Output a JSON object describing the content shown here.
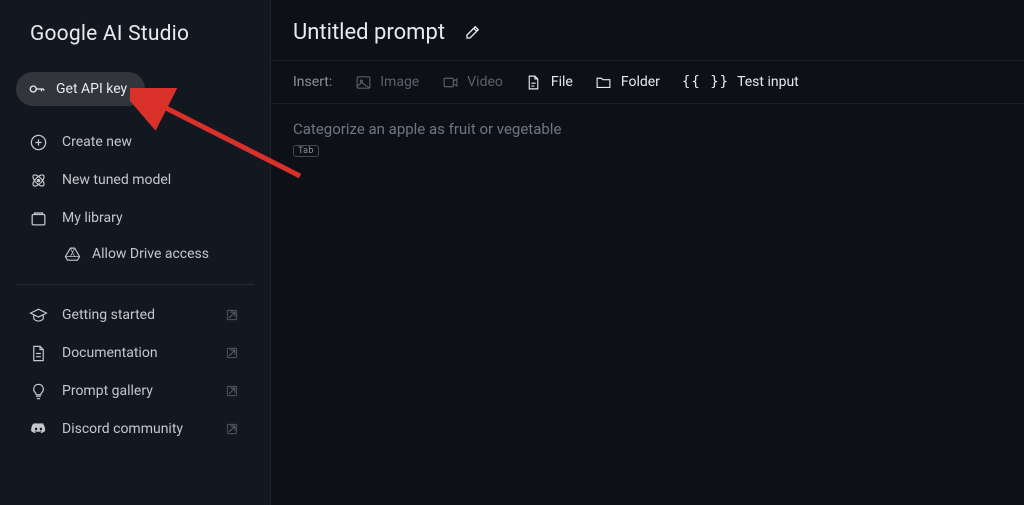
{
  "sidebar": {
    "brand": "Google AI Studio",
    "api_key_label": "Get API key",
    "nav_primary": [
      {
        "id": "create-new",
        "label": "Create new"
      },
      {
        "id": "new-tuned-model",
        "label": "New tuned model"
      },
      {
        "id": "my-library",
        "label": "My library"
      }
    ],
    "nav_sub": [
      {
        "id": "allow-drive-access",
        "label": "Allow Drive access"
      }
    ],
    "nav_secondary": [
      {
        "id": "getting-started",
        "label": "Getting started"
      },
      {
        "id": "documentation",
        "label": "Documentation"
      },
      {
        "id": "prompt-gallery",
        "label": "Prompt gallery"
      },
      {
        "id": "discord-community",
        "label": "Discord community"
      }
    ]
  },
  "main": {
    "title": "Untitled prompt",
    "insert": {
      "label": "Insert:",
      "items": [
        {
          "id": "image",
          "label": "Image",
          "enabled": false
        },
        {
          "id": "video",
          "label": "Video",
          "enabled": false
        },
        {
          "id": "file",
          "label": "File",
          "enabled": true
        },
        {
          "id": "folder",
          "label": "Folder",
          "enabled": true
        },
        {
          "id": "test-input",
          "label": "Test input",
          "enabled": true
        }
      ]
    },
    "prompt_placeholder": "Categorize an apple as fruit or vegetable",
    "tab_hint": "Tab"
  }
}
